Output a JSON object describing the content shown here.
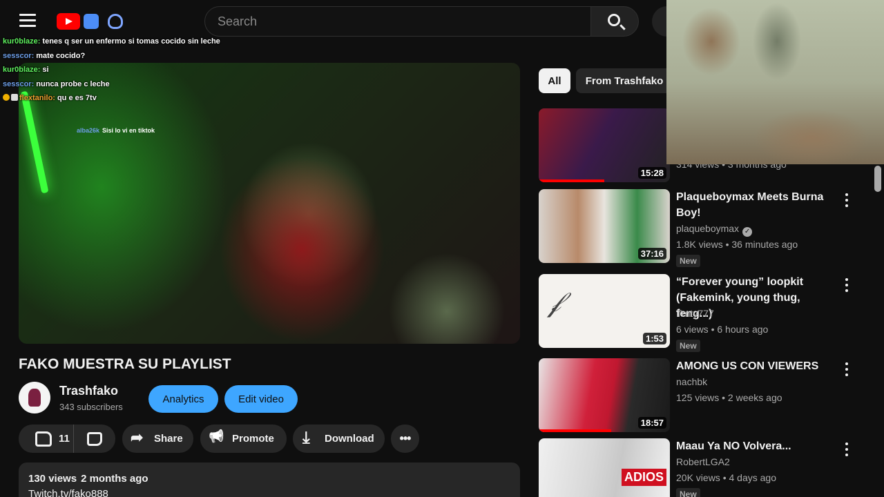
{
  "header": {
    "search_placeholder": "Search"
  },
  "chat": [
    {
      "user": "kur0blaze:",
      "message": "tenes q ser un enfermo si tomas cocido sin leche",
      "color": "green"
    },
    {
      "user": "sesscor:",
      "message": "mate cocido?",
      "color": "blue"
    },
    {
      "user": "kur0blaze:",
      "message": "si",
      "color": "green"
    },
    {
      "user": "sesscor:",
      "message": "nunca probe c leche",
      "color": "blue"
    },
    {
      "user": "flextanilo:",
      "message": "qu e es 7tv",
      "color": "orange"
    }
  ],
  "player_overlay_chat": {
    "user": "alba26k",
    "message": "Sisi lo vi en tiktok"
  },
  "video": {
    "title": "FAKO MUESTRA SU PLAYLIST",
    "channel": "Trashfako",
    "subscribers": "343 subscribers",
    "analytics_label": "Analytics",
    "edit_label": "Edit video",
    "likes": "11",
    "share_label": "Share",
    "promote_label": "Promote",
    "download_label": "Download",
    "views": "130 views",
    "age": "2 months ago",
    "description_link": "Twitch.tv/fako888"
  },
  "chips": {
    "all": "All",
    "from": "From Trashfako"
  },
  "recommendations": [
    {
      "title": "",
      "channel": "",
      "meta": "314 views • 3 months ago",
      "duration": "15:28",
      "progress": 0.5,
      "new": ""
    },
    {
      "title": "Plaqueboymax Meets Burna Boy!",
      "channel": "plaqueboymax",
      "verified": true,
      "meta": "1.8K views • 36 minutes ago",
      "duration": "37:16",
      "new": "New"
    },
    {
      "title": "“Forever young” loopkit (Fakemink, young thug, feng...)",
      "channel": "Trnty777",
      "meta": "6 views • 6 hours ago",
      "duration": "1:53",
      "new": "New"
    },
    {
      "title": "AMONG US CON VIEWERS",
      "channel": "nachbk",
      "meta": "125 views • 2 weeks ago",
      "duration": "18:57",
      "progress": 0.55,
      "new": ""
    },
    {
      "title": "Maau Ya NO Volvera...",
      "channel": "RobertLGA2",
      "meta": "20K views • 4 days ago",
      "duration": "",
      "new": "New"
    }
  ],
  "colors": {
    "accent_blue": "#3ea6ff",
    "youtube_red": "#ff0000",
    "background": "#0f0f0f"
  }
}
